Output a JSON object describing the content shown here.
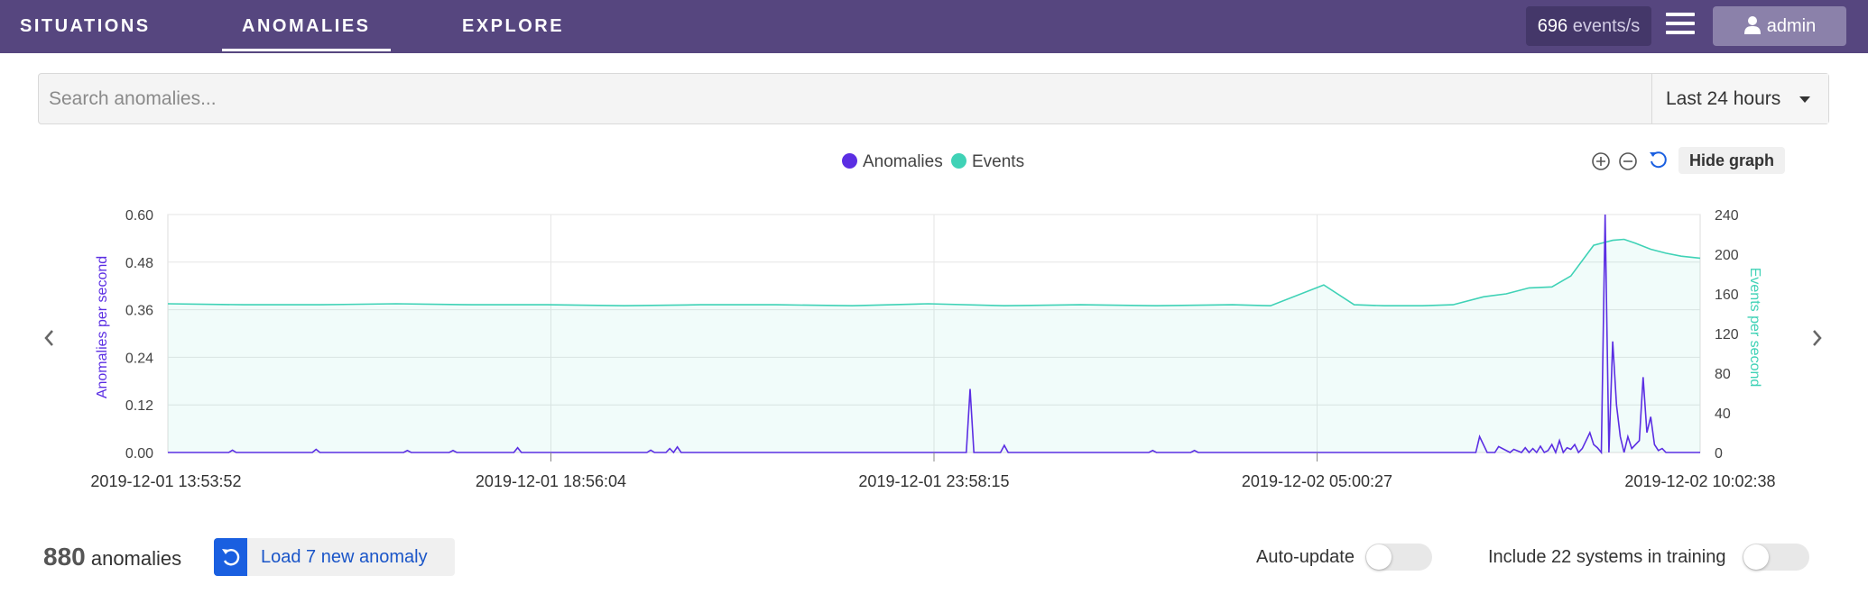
{
  "nav": {
    "tabs": [
      {
        "label": "SITUATIONS"
      },
      {
        "label": "ANOMALIES"
      },
      {
        "label": "EXPLORE"
      }
    ],
    "active": "ANOMALIES",
    "events_rate": {
      "value": "696",
      "unit": "events/s"
    },
    "user": "admin"
  },
  "search": {
    "placeholder": "Search anomalies...",
    "value": "",
    "time_range": "Last 24 hours"
  },
  "chart_controls": {
    "hide_label": "Hide graph",
    "icons": [
      "zoom-in-icon",
      "zoom-out-icon",
      "reset-zoom-icon"
    ]
  },
  "colors": {
    "topbar": "#56467f",
    "anomalies": "#5b2ee3",
    "events": "#3fd2b6",
    "accent": "#1a5fe0"
  },
  "chart_data": {
    "type": "line",
    "title": "",
    "legend": [
      "Anomalies",
      "Events"
    ],
    "legend_position": "top-center",
    "x_ticks": [
      "2019-12-01 13:53:52",
      "2019-12-01 18:56:04",
      "2019-12-01 23:58:15",
      "2019-12-02 05:00:27",
      "2019-12-02 10:02:38"
    ],
    "x_range_hours": [
      0,
      20.15
    ],
    "y_left": {
      "label": "Anomalies per second",
      "ticks": [
        "0.00",
        "0.12",
        "0.24",
        "0.36",
        "0.48",
        "0.60"
      ],
      "range": [
        0,
        0.6
      ]
    },
    "y_right": {
      "label": "Events per second",
      "ticks": [
        "0",
        "40",
        "80",
        "120",
        "160",
        "200",
        "240"
      ],
      "range": [
        0,
        240
      ]
    },
    "grid": true,
    "series": [
      {
        "name": "Anomalies",
        "axis": "left",
        "x": [
          0,
          0.8,
          0.85,
          0.9,
          1.9,
          1.95,
          2.0,
          3.1,
          3.15,
          3.2,
          3.7,
          3.75,
          3.8,
          4.55,
          4.6,
          4.65,
          6.3,
          6.35,
          6.4,
          6.55,
          6.6,
          6.65,
          6.7,
          6.75,
          6.8,
          10.5,
          10.55,
          10.6,
          10.65,
          10.95,
          11.0,
          11.05,
          12.9,
          12.95,
          13.0,
          13.45,
          13.5,
          13.55,
          17.2,
          17.25,
          17.35,
          17.45,
          17.5,
          17.65,
          17.7,
          17.8,
          17.85,
          17.9,
          17.95,
          18.0,
          18.05,
          18.1,
          18.15,
          18.2,
          18.25,
          18.3,
          18.35,
          18.4,
          18.45,
          18.5,
          18.55,
          18.6,
          18.65,
          18.7,
          18.75,
          18.8,
          18.85,
          18.9,
          18.95,
          19.0,
          19.05,
          19.1,
          19.15,
          19.2,
          19.25,
          19.3,
          19.35,
          19.4,
          19.45,
          19.5,
          19.55,
          19.6,
          19.65,
          19.7,
          19.75,
          19.8,
          19.85,
          19.9,
          19.95,
          20.0,
          20.05,
          20.1,
          20.15
        ],
        "y": [
          0,
          0,
          0.006,
          0,
          0,
          0.008,
          0,
          0,
          0.005,
          0,
          0,
          0.005,
          0,
          0,
          0.012,
          0,
          0,
          0.006,
          0,
          0,
          0.01,
          0,
          0.014,
          0,
          0,
          0,
          0.16,
          0,
          0,
          0,
          0.018,
          0,
          0,
          0.005,
          0,
          0,
          0.005,
          0,
          0,
          0.04,
          0,
          0,
          0.015,
          0,
          0.008,
          0,
          0.012,
          0,
          0.01,
          0,
          0.016,
          0,
          0.005,
          0.02,
          0,
          0.03,
          0,
          0.012,
          0.008,
          0.02,
          0,
          0.01,
          0.03,
          0.05,
          0.02,
          0.012,
          0,
          0.6,
          0,
          0.28,
          0.12,
          0.04,
          0,
          0.04,
          0.01,
          0.02,
          0.03,
          0.19,
          0.05,
          0.09,
          0.02,
          0.005,
          0.01,
          0,
          0,
          0,
          0,
          0,
          0,
          0,
          0,
          0,
          0
        ]
      },
      {
        "name": "Events",
        "axis": "right",
        "x": [
          0,
          1,
          2,
          3,
          4,
          5,
          6,
          7,
          8,
          9,
          10,
          11,
          12,
          13,
          14,
          14.5,
          15.2,
          15.6,
          16,
          16.5,
          16.9,
          17.3,
          17.6,
          17.9,
          18.2,
          18.45,
          18.75,
          19.0,
          19.15,
          19.3,
          19.5,
          19.7,
          19.9,
          20.15
        ],
        "y": [
          150,
          149,
          149,
          150,
          149,
          149,
          148,
          149,
          149,
          148,
          150,
          148,
          149,
          148,
          149,
          148,
          169,
          149,
          148,
          148,
          149,
          157,
          160,
          166,
          167,
          178,
          209,
          214,
          215,
          211,
          205,
          201,
          198,
          196
        ]
      }
    ]
  },
  "footer": {
    "count": "880",
    "count_label": "anomalies",
    "load_label": "Load 7 new anomaly",
    "auto_update_label": "Auto-update",
    "auto_update": false,
    "training_label": "Include 22 systems in training",
    "training": false
  }
}
